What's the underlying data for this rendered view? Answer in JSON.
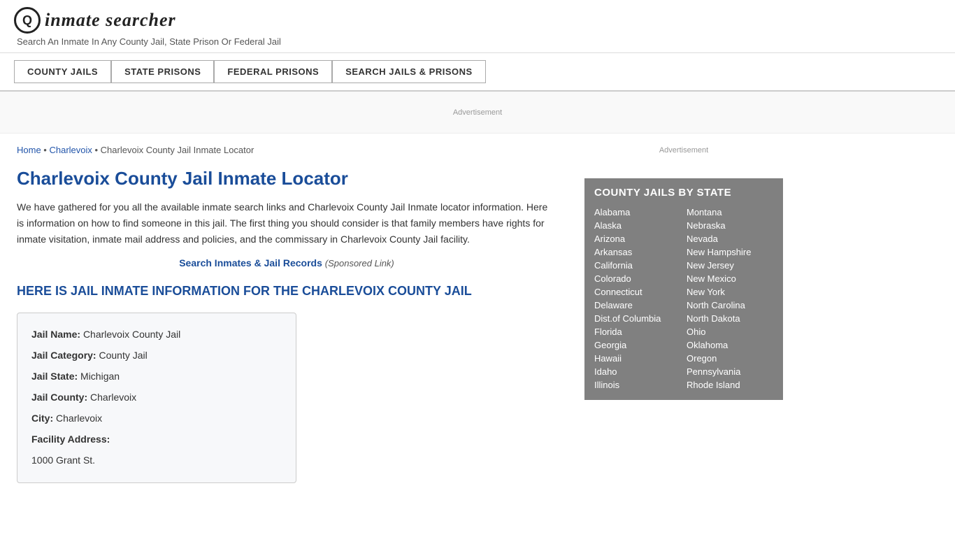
{
  "header": {
    "logo_icon": "🔍",
    "logo_text": "inmate searcher",
    "tagline": "Search An Inmate In Any County Jail, State Prison Or Federal Jail"
  },
  "nav": {
    "items": [
      {
        "label": "COUNTY JAILS",
        "id": "county-jails"
      },
      {
        "label": "STATE PRISONS",
        "id": "state-prisons"
      },
      {
        "label": "FEDERAL PRISONS",
        "id": "federal-prisons"
      },
      {
        "label": "SEARCH JAILS & PRISONS",
        "id": "search-jails"
      }
    ]
  },
  "ad_label": "Advertisement",
  "breadcrumb": {
    "home": "Home",
    "parent": "Charlevoix",
    "current": "Charlevoix County Jail Inmate Locator"
  },
  "page_title": "Charlevoix County Jail Inmate Locator",
  "intro_text": "We have gathered for you all the available inmate search links and Charlevoix County Jail Inmate locator information. Here is information on how to find someone in this jail. The first thing you should consider is that family members have rights for inmate visitation, inmate mail address and policies, and the commissary in Charlevoix County Jail facility.",
  "sponsored": {
    "link_text": "Search Inmates & Jail Records",
    "suffix": "(Sponsored Link)"
  },
  "section_heading": "HERE IS JAIL INMATE INFORMATION FOR THE CHARLEVOIX COUNTY JAIL",
  "jail_info": {
    "name_label": "Jail Name:",
    "name_value": "Charlevoix County Jail",
    "category_label": "Jail Category:",
    "category_value": "County Jail",
    "state_label": "Jail State:",
    "state_value": "Michigan",
    "county_label": "Jail County:",
    "county_value": "Charlevoix",
    "city_label": "City:",
    "city_value": "Charlevoix",
    "address_label": "Facility Address:",
    "address_value": "1000 Grant St."
  },
  "sidebar": {
    "ad_label": "Advertisement",
    "state_box_title": "COUNTY JAILS BY STATE",
    "states_left": [
      "Alabama",
      "Alaska",
      "Arizona",
      "Arkansas",
      "California",
      "Colorado",
      "Connecticut",
      "Delaware",
      "Dist.of Columbia",
      "Florida",
      "Georgia",
      "Hawaii",
      "Idaho",
      "Illinois"
    ],
    "states_right": [
      "Montana",
      "Nebraska",
      "Nevada",
      "New Hampshire",
      "New Jersey",
      "New Mexico",
      "New York",
      "North Carolina",
      "North Dakota",
      "Ohio",
      "Oklahoma",
      "Oregon",
      "Pennsylvania",
      "Rhode Island"
    ]
  }
}
